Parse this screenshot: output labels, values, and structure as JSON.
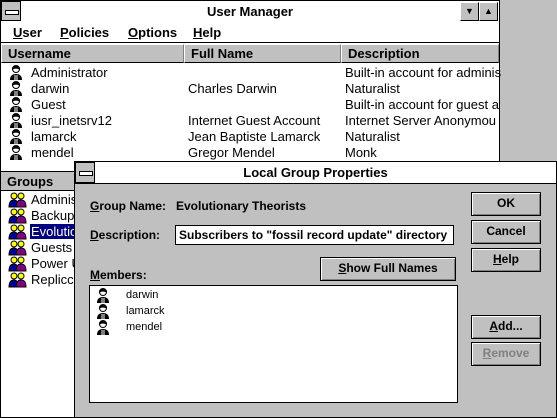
{
  "window": {
    "title": "User Manager",
    "min_glyph": "▼",
    "max_glyph": "▲"
  },
  "menu": [
    {
      "accel": "U",
      "rest": "ser"
    },
    {
      "accel": "P",
      "rest": "olicies"
    },
    {
      "accel": "O",
      "rest": "ptions"
    },
    {
      "accel": "H",
      "rest": "elp"
    }
  ],
  "users_table": {
    "headers": [
      "Username",
      "Full Name",
      "Description"
    ],
    "rows": [
      {
        "username": "Administrator",
        "fullname": "",
        "description": "Built-in account for adminis"
      },
      {
        "username": "darwin",
        "fullname": "Charles Darwin",
        "description": "Naturalist"
      },
      {
        "username": "Guest",
        "fullname": "",
        "description": "Built-in account for guest a"
      },
      {
        "username": "iusr_inetsrv12",
        "fullname": "Internet Guest Account",
        "description": "Internet Server Anonymou"
      },
      {
        "username": "lamarck",
        "fullname": "Jean Baptiste Lamarck",
        "description": "Naturalist"
      },
      {
        "username": "mendel",
        "fullname": "Gregor Mendel",
        "description": "Monk"
      }
    ]
  },
  "groups": {
    "header": "Groups",
    "items": [
      "Adminis",
      "Backup",
      "Evolutio",
      "Guests",
      "Power U",
      "Replicc"
    ],
    "selected_index": 2
  },
  "dialog": {
    "title": "Local Group Properties",
    "group_name_label": {
      "accel": "G",
      "rest": "roup Name:"
    },
    "group_name_value": "Evolutionary Theorists",
    "description_label": {
      "accel": "D",
      "rest": "escription:"
    },
    "description_value": "Subscribers to \"fossil record update\" directory",
    "members_label": {
      "accel": "M",
      "rest": "embers:"
    },
    "members": [
      "darwin",
      "lamarck",
      "mendel"
    ],
    "buttons": {
      "ok": "OK",
      "cancel": "Cancel",
      "help": {
        "accel": "H",
        "rest": "elp"
      },
      "show_full_names": {
        "accel": "S",
        "rest": "how Full Names"
      },
      "add": {
        "accel": "A",
        "rest": "dd..."
      },
      "remove": {
        "accel": "R",
        "rest": "emove"
      }
    }
  }
}
